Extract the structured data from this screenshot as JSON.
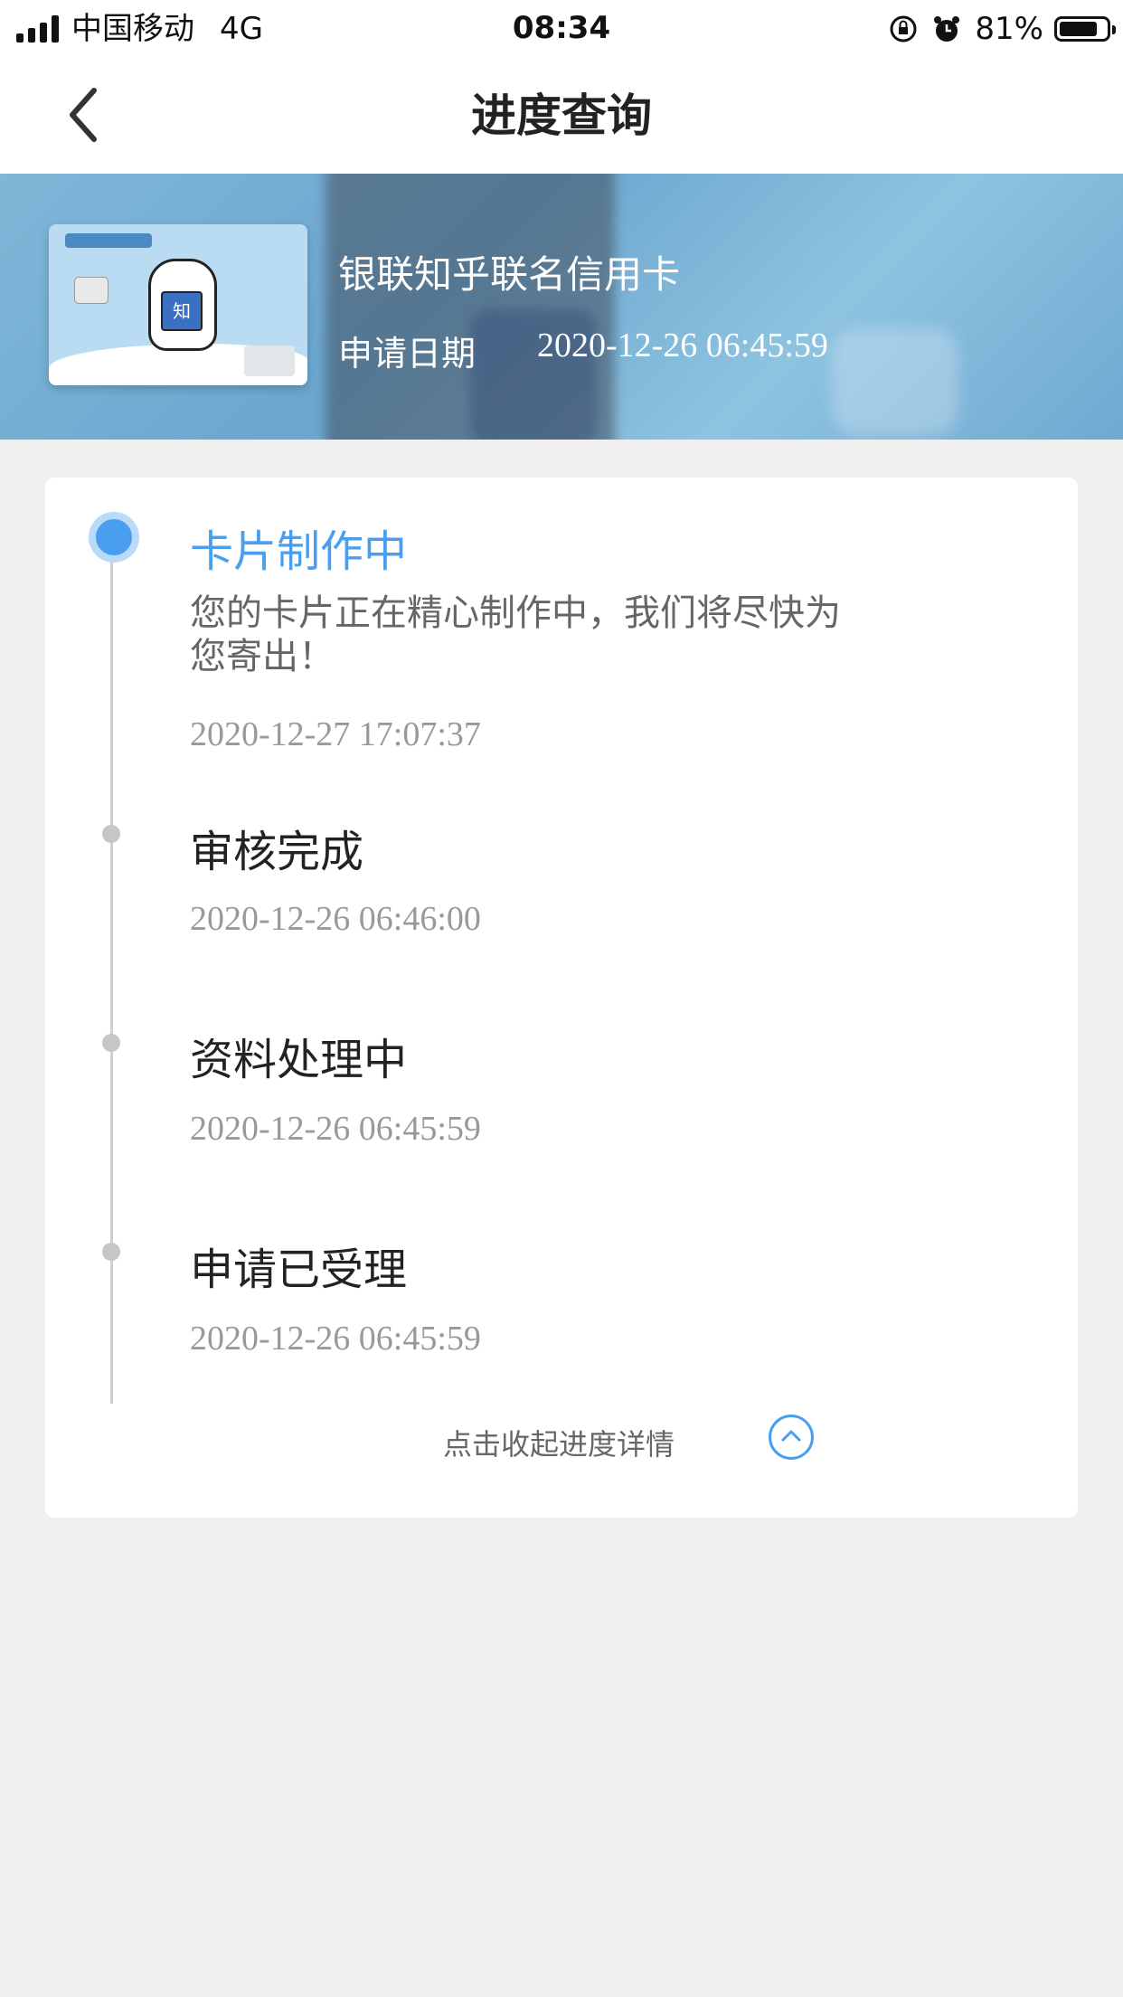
{
  "status_bar": {
    "carrier": "中国移动",
    "network": "4G",
    "time": "08:34",
    "battery": "81%",
    "battery_level": 0.81
  },
  "nav": {
    "title": "进度查询",
    "back_icon": "chevron-left-icon"
  },
  "card": {
    "name": "银联知乎联名信用卡",
    "date_label": "申请日期",
    "date_value": "2020-12-26 06:45:59",
    "badge_text": "知"
  },
  "timeline": [
    {
      "title": "卡片制作中",
      "desc": "您的卡片正在精心制作中，我们将尽快为您寄出！",
      "time": "2020-12-27 17:07:37",
      "active": true
    },
    {
      "title": "审核完成",
      "time": "2020-12-26 06:46:00",
      "active": false
    },
    {
      "title": "资料处理中",
      "time": "2020-12-26 06:45:59",
      "active": false
    },
    {
      "title": "申请已受理",
      "time": "2020-12-26 06:45:59",
      "active": false
    }
  ],
  "collapse": {
    "label": "点击收起进度详情",
    "icon": "chevron-up-circle-icon"
  },
  "colors": {
    "accent": "#4a9ef0",
    "background": "#efeff0",
    "text_primary": "#222222",
    "text_muted": "#999999"
  }
}
